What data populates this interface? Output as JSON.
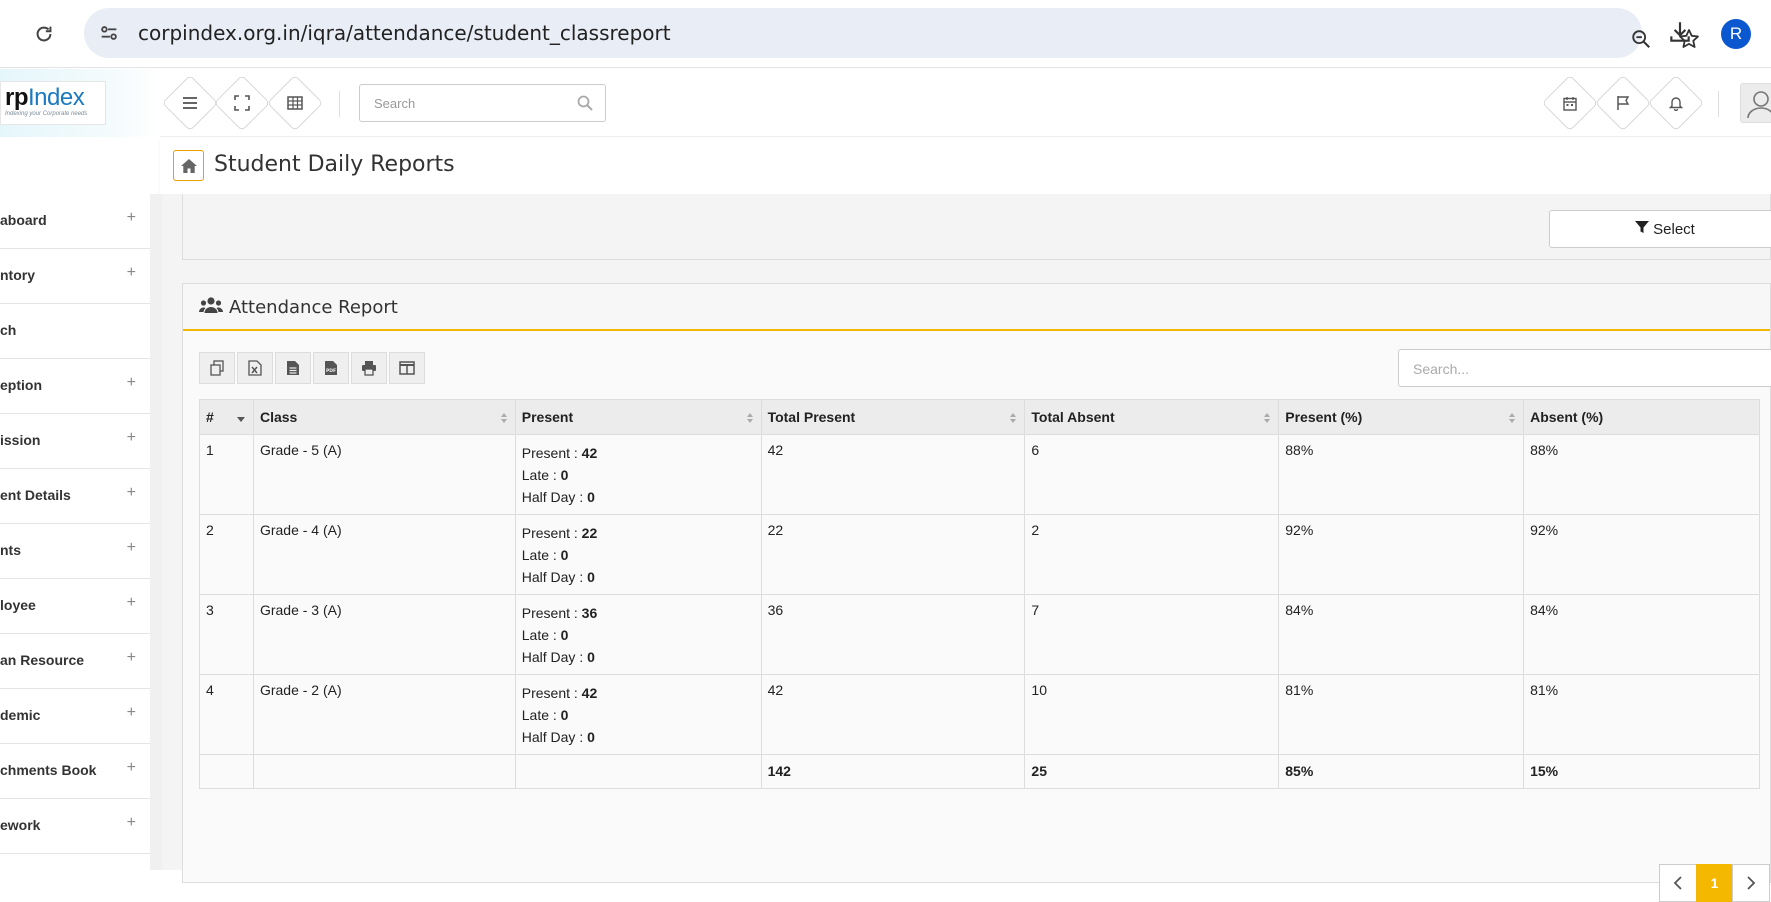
{
  "browser": {
    "url": "corpindex.org.in/iqra/attendance/student_classreport",
    "profile_initial": "R"
  },
  "header": {
    "logo_main": "rpIndex",
    "logo_rp": "rp",
    "logo_index": "Index",
    "logo_tagline": "Indexing your Corporate needs",
    "search_placeholder": "Search"
  },
  "page": {
    "title": "Student Daily Reports"
  },
  "sidebar": {
    "items": [
      {
        "label": "aboard",
        "has_plus": true
      },
      {
        "label": "ntory",
        "has_plus": true
      },
      {
        "label": "ch",
        "has_plus": false
      },
      {
        "label": "eption",
        "has_plus": true
      },
      {
        "label": "ission",
        "has_plus": true
      },
      {
        "label": "ent Details",
        "has_plus": true
      },
      {
        "label": "nts",
        "has_plus": true
      },
      {
        "label": "loyee",
        "has_plus": true
      },
      {
        "label": "an Resource",
        "has_plus": true
      },
      {
        "label": "demic",
        "has_plus": true
      },
      {
        "label": "chments Book",
        "has_plus": true
      },
      {
        "label": "ework",
        "has_plus": true
      }
    ],
    "plus": "+"
  },
  "filter": {
    "select_label": "Select"
  },
  "report": {
    "title": "Attendance Report",
    "search_placeholder": "Search...",
    "columns": [
      "#",
      "Class",
      "Present",
      "Total Present",
      "Total Absent",
      "Present (%)",
      "Absent (%)"
    ],
    "present_label": "Present : ",
    "late_label": "Late : ",
    "halfday_label": "Half Day : ",
    "rows": [
      {
        "num": "1",
        "class": "Grade - 5 (A)",
        "present": "42",
        "late": "0",
        "half_day": "0",
        "total_present": "42",
        "total_absent": "6",
        "present_pct": "88%",
        "absent_pct": "88%"
      },
      {
        "num": "2",
        "class": "Grade - 4 (A)",
        "present": "22",
        "late": "0",
        "half_day": "0",
        "total_present": "22",
        "total_absent": "2",
        "present_pct": "92%",
        "absent_pct": "92%"
      },
      {
        "num": "3",
        "class": "Grade - 3 (A)",
        "present": "36",
        "late": "0",
        "half_day": "0",
        "total_present": "36",
        "total_absent": "7",
        "present_pct": "84%",
        "absent_pct": "84%"
      },
      {
        "num": "4",
        "class": "Grade - 2 (A)",
        "present": "42",
        "late": "0",
        "half_day": "0",
        "total_present": "42",
        "total_absent": "10",
        "present_pct": "81%",
        "absent_pct": "81%"
      }
    ],
    "totals": {
      "total_present": "142",
      "total_absent": "25",
      "present_pct": "85%",
      "absent_pct": "15%"
    }
  },
  "pagination": {
    "prev": "‹",
    "current": "1",
    "next": "›",
    "active_color": "#f5b800"
  },
  "colors": {
    "accent": "#f5b800",
    "brand_blue": "#1c79c0"
  }
}
